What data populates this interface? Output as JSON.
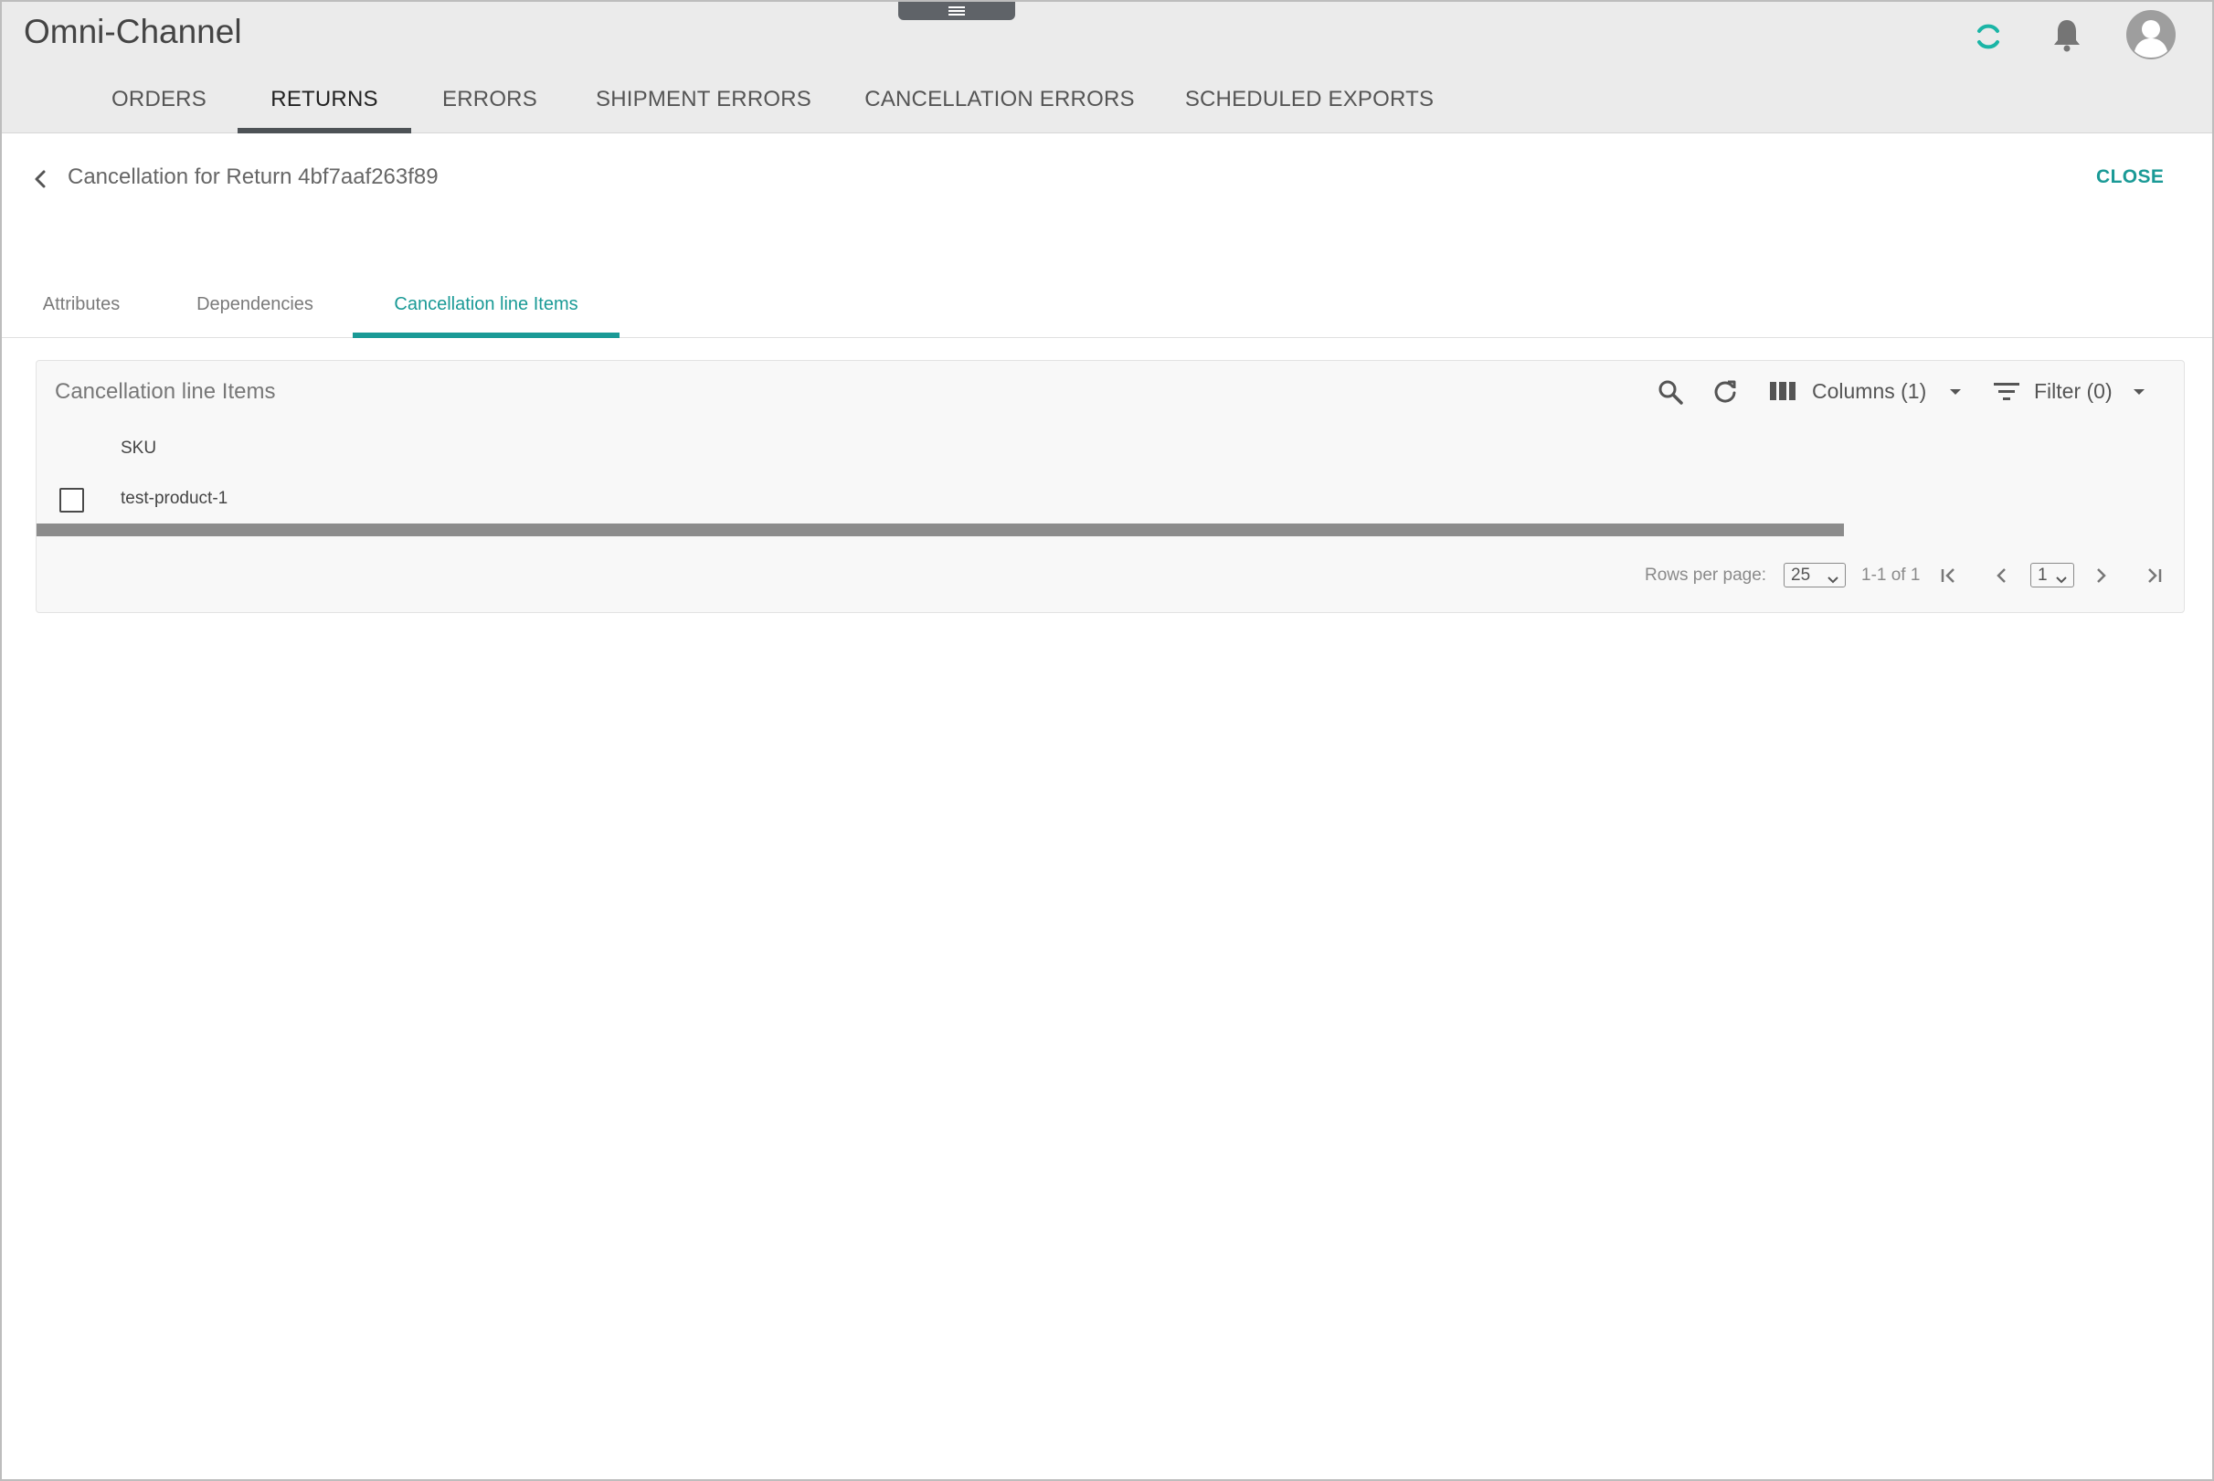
{
  "app": {
    "title": "Omni-Channel",
    "loading_color": "#1ab5a6"
  },
  "nav": {
    "tabs": [
      {
        "label": "ORDERS",
        "active": false
      },
      {
        "label": "RETURNS",
        "active": true
      },
      {
        "label": "ERRORS",
        "active": false
      },
      {
        "label": "SHIPMENT ERRORS",
        "active": false
      },
      {
        "label": "CANCELLATION ERRORS",
        "active": false
      },
      {
        "label": "SCHEDULED EXPORTS",
        "active": false
      }
    ]
  },
  "detail": {
    "title": "Cancellation for Return 4bf7aaf263f89",
    "close_label": "CLOSE"
  },
  "subtabs": [
    {
      "label": "Attributes",
      "active": false
    },
    {
      "label": "Dependencies",
      "active": false
    },
    {
      "label": "Cancellation line Items",
      "active": true
    }
  ],
  "card": {
    "title": "Cancellation line Items",
    "toolbar": {
      "columns_label": "Columns (1)",
      "filter_label": "Filter (0)"
    },
    "table": {
      "columns": [
        "SKU"
      ],
      "rows": [
        {
          "checked": false,
          "cells": [
            "test-product-1"
          ]
        }
      ]
    },
    "pagination": {
      "rows_per_page_label": "Rows per page:",
      "rows_per_page_value": "25",
      "range_text": "1-1 of 1",
      "page_value": "1"
    }
  },
  "colors": {
    "accent": "#1a9a96",
    "header_bg": "#ebebeb",
    "active_nav_underline": "#4d5256"
  },
  "icons": {
    "menu": "menu-handle-icon",
    "loading": "loading-spinner-icon",
    "notifications": "bell-icon",
    "account": "avatar-icon",
    "back": "chevron-left-icon",
    "search": "search-icon",
    "refresh": "refresh-icon",
    "columns": "columns-icon",
    "filter": "filter-icon",
    "dropdown": "caret-down-icon",
    "first_page": "first-page-icon",
    "prev_page": "chevron-left-icon",
    "next_page": "chevron-right-icon",
    "last_page": "last-page-icon"
  }
}
